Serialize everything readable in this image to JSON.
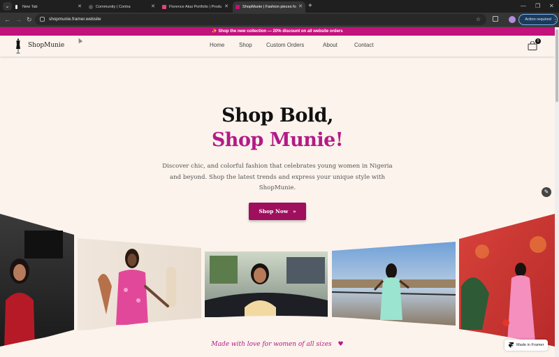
{
  "browser": {
    "tabs": [
      {
        "title": "New Tab",
        "favicon_color": "#e8e8e8"
      },
      {
        "title": "Community | Contra",
        "favicon_color": "#d0d0d0"
      },
      {
        "title": "Florence Akai Portfolio | Produ",
        "favicon_color": "#e0457b"
      },
      {
        "title": "ShopMunie | Fashion pieces fo",
        "favicon_color": "#c2127b",
        "active": true
      }
    ],
    "new_tab_label": "+",
    "url": "shopmunie.framer.website",
    "action_required_label": "Action required",
    "window_controls": {
      "minimize": "—",
      "maximize": "❐",
      "close": "✕"
    }
  },
  "page": {
    "announcement": "✨ Shop the new collection — 20% discount on all website orders",
    "logo_text": "ShopMunie",
    "nav": [
      "Home",
      "Shop",
      "Custom Orders",
      "About",
      "Contact"
    ],
    "cart_count": "0",
    "hero": {
      "title_line_1": "Shop Bold,",
      "title_line_2": "Shop Munie!",
      "description": "Discover  chic, and colorful fashion that celebrates young women in Nigeria and beyond. Shop the latest trends and express your unique style with ShopMunie.",
      "cta_label": "Shop Now",
      "cta_icon": "»"
    },
    "footer_tagline": "Made with love for women of all sizes",
    "made_in_framer": "Made in Framer"
  },
  "colors": {
    "brand_magenta": "#c2127b",
    "cta": "#9e0f5e",
    "title_accent": "#b31a86",
    "page_bg": "#fbf3ec"
  }
}
